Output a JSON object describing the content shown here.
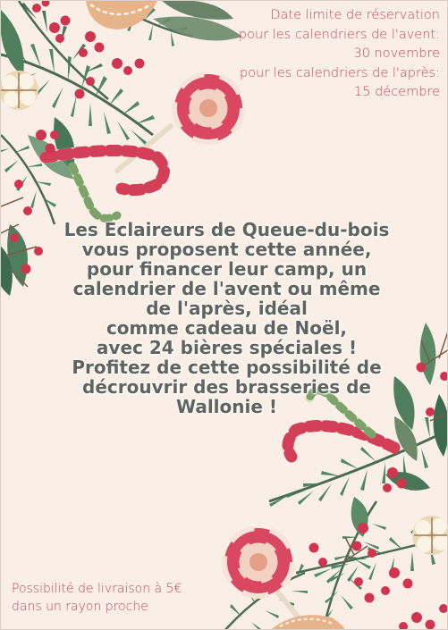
{
  "deadline": {
    "lines": [
      "Date limite de réservation",
      "pour les calendriers de l'avent:",
      "30 novembre",
      "pour les calendriers de l'après:",
      "15 décembre"
    ]
  },
  "announcement": {
    "lines": [
      "Les Eclaireurs de Queue-du-bois",
      "vous proposent cette année,",
      "pour financer leur camp, un",
      "calendrier de l'avent ou même",
      "de l'après, idéal",
      "comme cadeau de Noël,",
      "avec 24 bières spéciales !",
      "Profitez de cette possibilité de",
      "décrouvrir des brasseries de",
      "Wallonie !"
    ]
  },
  "delivery": {
    "lines": [
      "Possibilité de livraison à 5€",
      "dans un rayon proche"
    ]
  },
  "colors": {
    "background": "#f9efe7",
    "accent_red": "#c8465a",
    "main_text": "#5f6460",
    "pine_green": "#3f7b5c",
    "berry_red": "#d1344f"
  }
}
